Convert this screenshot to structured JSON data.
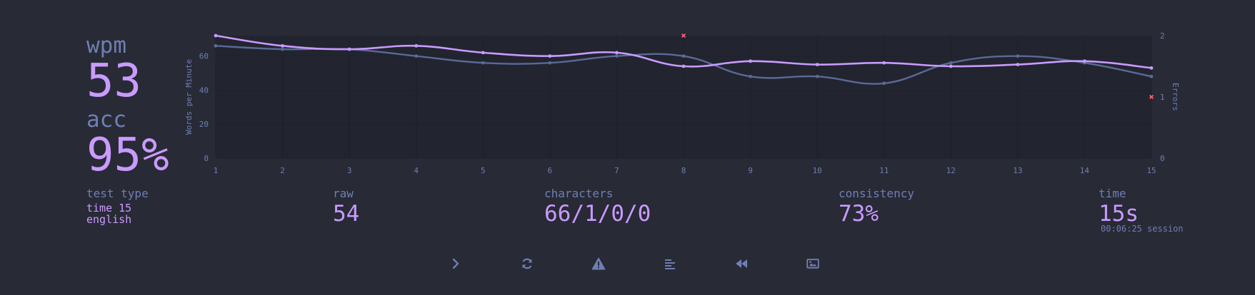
{
  "stats": {
    "wpm_label": "wpm",
    "wpm_value": "53",
    "acc_label": "acc",
    "acc_value": "95%"
  },
  "details": {
    "test_type_label": "test type",
    "test_type_line1": "time 15",
    "test_type_line2": "english",
    "raw_label": "raw",
    "raw_value": "54",
    "characters_label": "characters",
    "characters_value": "66/1/0/0",
    "consistency_label": "consistency",
    "consistency_value": "73%",
    "time_label": "time",
    "time_value": "15s",
    "session_note": "00:06:25 session"
  },
  "buttons": [
    {
      "name": "next-test-button",
      "icon": "chevron-right-icon"
    },
    {
      "name": "restart-test-button",
      "icon": "refresh-icon"
    },
    {
      "name": "practice-errors-button",
      "icon": "warning-icon"
    },
    {
      "name": "words-history-button",
      "icon": "align-left-icon"
    },
    {
      "name": "watch-replay-button",
      "icon": "backward-icon"
    },
    {
      "name": "save-screenshot-button",
      "icon": "image-icon"
    }
  ],
  "colors": {
    "background": "#282a36",
    "accent": "#c99bff",
    "muted": "#6f7fb2",
    "error": "#ff5f6d"
  },
  "chart_data": {
    "type": "line",
    "x": [
      1,
      2,
      3,
      4,
      5,
      6,
      7,
      8,
      9,
      10,
      11,
      12,
      13,
      14,
      15
    ],
    "ylabel": "Words per Minute",
    "y2label": "Errors",
    "ylim": [
      0,
      72
    ],
    "y2lim": [
      0,
      2
    ],
    "yticks": [
      0,
      20,
      40,
      60
    ],
    "y2ticks": [
      0,
      1,
      2
    ],
    "series": [
      {
        "role": "wpm",
        "color": "#c99bff",
        "values": [
          72,
          66,
          64,
          66,
          62,
          60,
          62,
          54,
          57,
          55,
          56,
          54,
          55,
          57,
          53
        ]
      },
      {
        "role": "raw",
        "color": "#5a6a94",
        "values": [
          66,
          64,
          64,
          60,
          56,
          56,
          60,
          60,
          48,
          48,
          44,
          56,
          60,
          56,
          48
        ]
      }
    ],
    "errors": [
      {
        "x": 8,
        "value": 2
      },
      {
        "x": 15,
        "value": 1
      }
    ],
    "grid": true
  }
}
